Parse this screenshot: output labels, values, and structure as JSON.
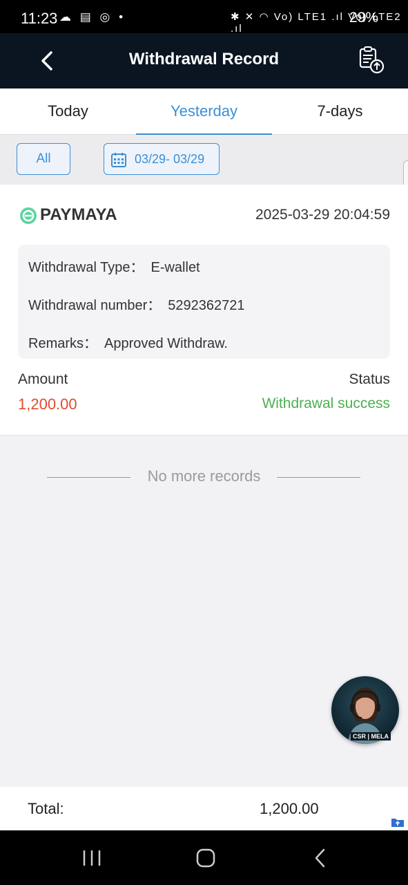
{
  "status_bar": {
    "time": "11:23",
    "left_icons": "☁ ▤ ◎ •",
    "right_icons": "✱ ✕ ◠ Vo) LTE1 .ıl Vo) LTE2 .ıl",
    "battery": "29%"
  },
  "header": {
    "title": "Withdrawal Record"
  },
  "tabs": [
    {
      "label": "Today",
      "active": false
    },
    {
      "label": "Yesterday",
      "active": true
    },
    {
      "label": "7-days",
      "active": false
    }
  ],
  "filters": {
    "all_label": "All",
    "date_range": "03/29- 03/29"
  },
  "record": {
    "brand": "PAYMAYA",
    "datetime": "2025-03-29 20:04:59",
    "type_label": "Withdrawal Type：",
    "type_value": "E-wallet",
    "number_label": "Withdrawal number：",
    "number_value": "5292362721",
    "remarks_label": "Remarks：",
    "remarks_value": "Approved Withdraw.",
    "amount_label": "Amount",
    "amount_value": "1,200.00",
    "status_label": "Status",
    "status_value": "Withdrawal success"
  },
  "list_end_text": "No more records",
  "support": {
    "badge": "CSR | MELA"
  },
  "footer": {
    "total_label": "Total:",
    "total_value": "1,200.00"
  },
  "colors": {
    "accent": "#3b8fd6",
    "amount": "#e24b2f",
    "success": "#4caf50",
    "header_bg": "#0b1522"
  }
}
